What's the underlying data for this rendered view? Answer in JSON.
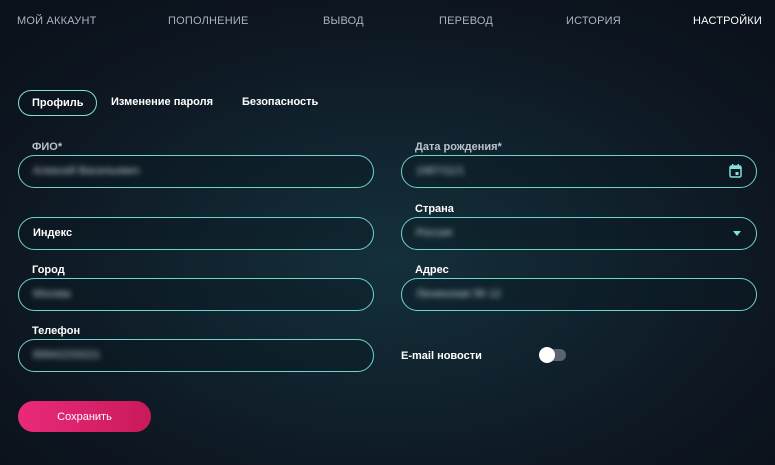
{
  "topnav": {
    "items": [
      {
        "label": "МОЙ АККАУНТ",
        "active": false
      },
      {
        "label": "ПОПОЛНЕНИЕ",
        "active": false
      },
      {
        "label": "ВЫВОД",
        "active": false
      },
      {
        "label": "ПЕРЕВОД",
        "active": false
      },
      {
        "label": "ИСТОРИЯ",
        "active": false
      },
      {
        "label": "НАСТРОЙКИ",
        "active": true
      }
    ]
  },
  "tabs": [
    {
      "label": "Профиль",
      "active": true
    },
    {
      "label": "Изменение пароля",
      "active": false
    },
    {
      "label": "Безопасность",
      "active": false
    }
  ],
  "form": {
    "fio": {
      "label": "ФИО*",
      "value": "Алексей Васильевич"
    },
    "birthdate": {
      "label": "Дата рождения*",
      "value": "1987/11/1"
    },
    "index": {
      "placeholder": "Индекс"
    },
    "country": {
      "label": "Страна",
      "value": "Россия"
    },
    "city": {
      "label": "Город",
      "value": "Москва"
    },
    "address": {
      "label": "Адрес",
      "value": "Ленинская 56 12"
    },
    "phone": {
      "label": "Телефон",
      "value": "89942233221"
    },
    "email_news": {
      "label": "E-mail новости",
      "enabled": false
    }
  },
  "save_button": {
    "label": "Сохранить"
  },
  "colors": {
    "accent_border": "#6fd3cf",
    "primary_button": "#e0266f",
    "background": "#0e1622"
  },
  "icons": {
    "calendar": "calendar-icon",
    "dropdown": "chevron-down-icon"
  }
}
